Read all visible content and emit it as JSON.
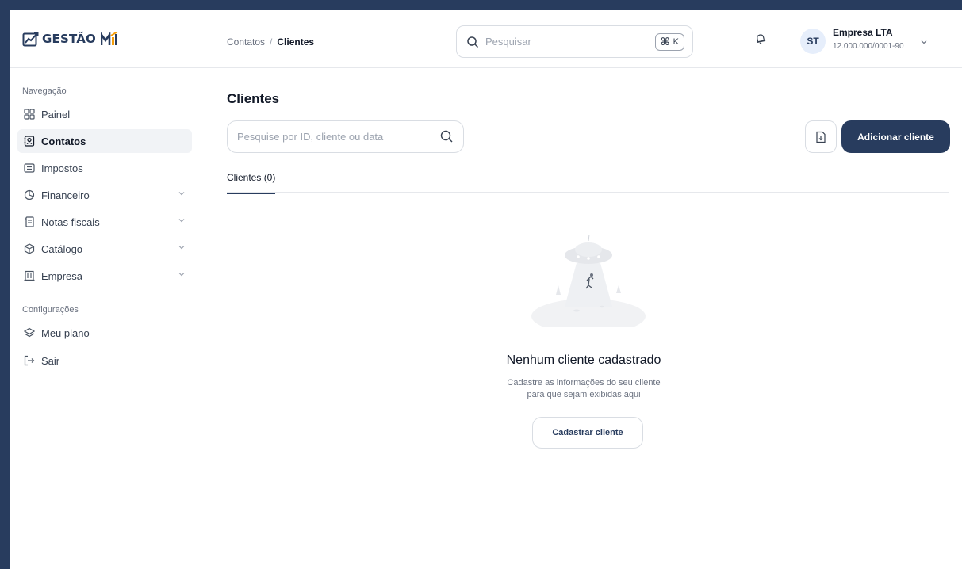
{
  "brand": {
    "name": "GESTÃO"
  },
  "sidebar": {
    "section_nav": "Navegação",
    "section_config": "Configurações",
    "items": [
      {
        "label": "Painel",
        "icon": "grid-icon"
      },
      {
        "label": "Contatos",
        "icon": "contact-card-icon",
        "active": true
      },
      {
        "label": "Impostos",
        "icon": "document-list-icon"
      },
      {
        "label": "Financeiro",
        "icon": "chart-pie-icon",
        "expandable": true
      },
      {
        "label": "Notas fiscais",
        "icon": "receipt-icon",
        "expandable": true
      },
      {
        "label": "Catálogo",
        "icon": "box-icon",
        "expandable": true
      },
      {
        "label": "Empresa",
        "icon": "building-icon",
        "expandable": true
      }
    ],
    "config_items": [
      {
        "label": "Meu plano",
        "icon": "layers-icon"
      },
      {
        "label": "Sair",
        "icon": "logout-icon"
      }
    ]
  },
  "header": {
    "breadcrumb": [
      "Contatos",
      "Clientes"
    ],
    "breadcrumb_sep": "/",
    "search_placeholder": "Pesquisar",
    "shortcut_key": "K",
    "shortcut_cmd": "⌘",
    "avatar_initials": "ST",
    "company_name": "Empresa LTA",
    "company_id": "12.000.000/0001-90"
  },
  "main": {
    "title": "Clientes",
    "search_placeholder": "Pesquise por ID, cliente ou data",
    "add_button": "Adicionar cliente",
    "tab_label": "Clientes (0)",
    "empty_title": "Nenhum cliente cadastrado",
    "empty_desc_line1": "Cadastre as informações do seu cliente",
    "empty_desc_line2": "para que sejam exibidas aqui",
    "register_button": "Cadastrar cliente"
  },
  "colors": {
    "primary": "#283c5e",
    "accent_logo": "#f59e0b",
    "border": "#e6e8ec",
    "muted_text": "#6b7280"
  }
}
